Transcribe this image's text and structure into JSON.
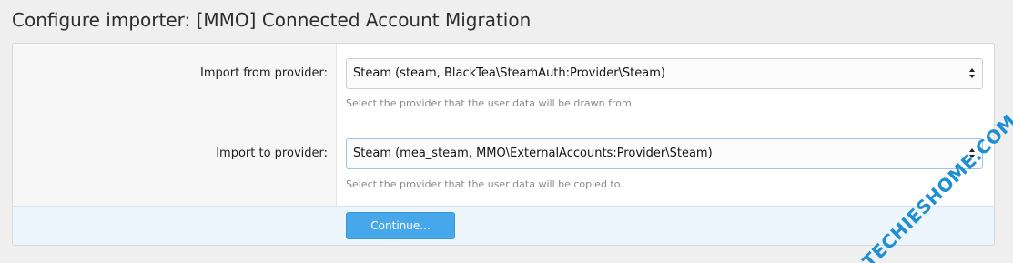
{
  "page": {
    "title": "Configure importer: [MMO] Connected Account Migration"
  },
  "form": {
    "rows": [
      {
        "label": "Import from provider:",
        "selected": "Steam (steam, BlackTea\\SteamAuth:Provider\\Steam)",
        "hint": "Select the provider that the user data will be drawn from."
      },
      {
        "label": "Import to provider:",
        "selected": "Steam (mea_steam, MMO\\ExternalAccounts:Provider\\Steam)",
        "hint": "Select the provider that the user data will be copied to."
      }
    ],
    "submit_label": "Continue..."
  },
  "watermark": {
    "text": "TECHIESHOME.COM",
    "color": "#1f8fd4"
  },
  "colors": {
    "button_bg": "#47a7eb",
    "submit_row_bg": "#edf6fd"
  }
}
